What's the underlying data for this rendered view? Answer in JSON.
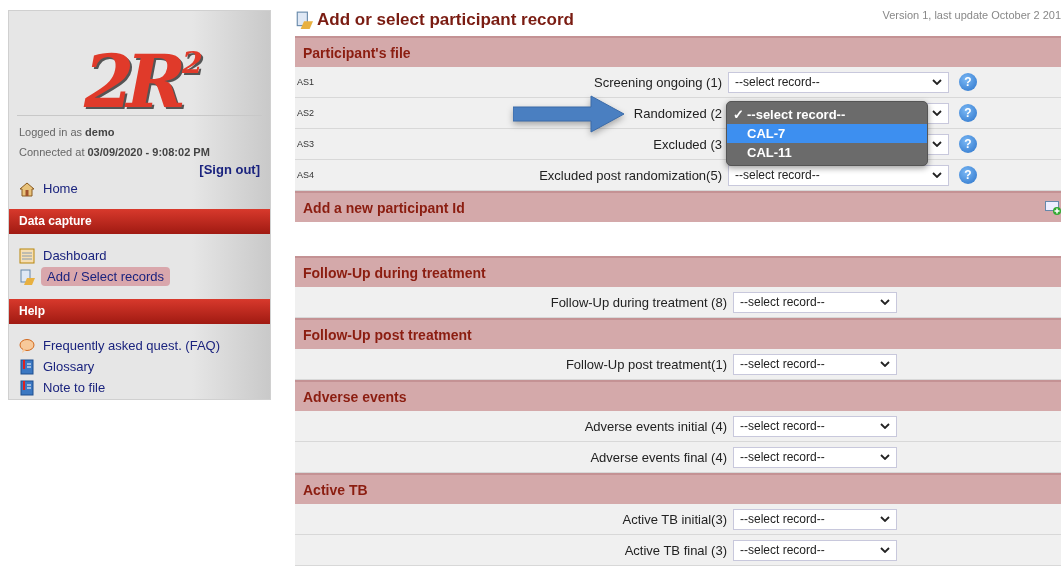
{
  "sidebar": {
    "logo": {
      "text": "2R",
      "sup": "2"
    },
    "login": "Logged in as **demo**",
    "connected": "Connected at **03/09/2020 - 9:08:02 PM**",
    "sign_out": "[Sign out]",
    "home": "Home",
    "sections": [
      {
        "title": "Data capture",
        "items": [
          {
            "label": "Dashboard",
            "kind": "dashboard",
            "selected": false
          },
          {
            "label": "Add / Select records",
            "kind": "records",
            "selected": true
          }
        ]
      },
      {
        "title": "Help",
        "items": [
          {
            "label": "Frequently asked quest. (FAQ)",
            "kind": "faq",
            "selected": false
          },
          {
            "label": "Glossary",
            "kind": "book",
            "selected": false
          },
          {
            "label": "Note to file",
            "kind": "book",
            "selected": false
          }
        ]
      }
    ]
  },
  "page": {
    "title": "Add or select participant record",
    "version": "Version 1, last update October 2 201"
  },
  "groups": [
    {
      "title": "Participant's file",
      "kind": "section",
      "rows": [
        {
          "code": "AS1",
          "label": "Screening ongoing (1)",
          "value": "--select record--",
          "help": "?"
        },
        {
          "code": "AS2",
          "label": "Randomized (2",
          "help": "?",
          "open": true,
          "check_mark": "✓",
          "options": [
            {
              "label": "--select record--",
              "checked": true,
              "selected": false
            },
            {
              "label": "CAL-7",
              "checked": false,
              "selected": true
            },
            {
              "label": "CAL-11",
              "checked": false,
              "selected": false
            }
          ]
        },
        {
          "code": "AS3",
          "label": "Excluded (3",
          "help": "?"
        },
        {
          "code": "AS4",
          "label": "Excluded post randomization(5)",
          "value": "--select record--",
          "help": "?"
        }
      ]
    },
    {
      "title": "Add a new participant Id",
      "kind": "action"
    },
    {
      "title": "Follow-Up during treatment",
      "kind": "section",
      "rows": [
        {
          "label": "Follow-Up during treatment (8)",
          "value": "--select record--"
        }
      ]
    },
    {
      "title": "Follow-Up post treatment",
      "kind": "section",
      "rows": [
        {
          "label": "Follow-Up post treatment(1)",
          "value": "--select record--"
        }
      ]
    },
    {
      "title": "Adverse events",
      "kind": "section",
      "rows": [
        {
          "label": "Adverse events initial (4)",
          "value": "--select record--"
        },
        {
          "label": "Adverse events final (4)",
          "value": "--select record--"
        }
      ]
    },
    {
      "title": "Active TB",
      "kind": "section",
      "rows": [
        {
          "label": "Active TB initial(3)",
          "value": "--select record--"
        },
        {
          "label": "Active TB final (3)",
          "value": "--select record--"
        }
      ]
    }
  ]
}
